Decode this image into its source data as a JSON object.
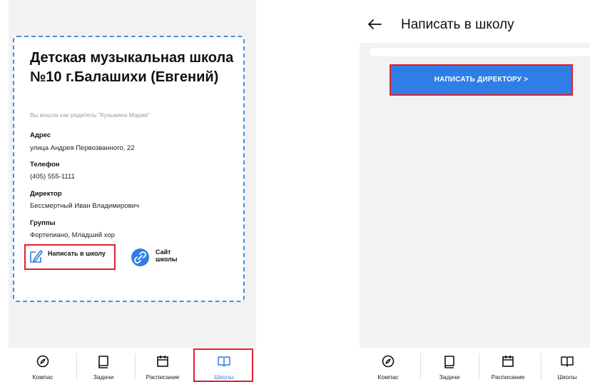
{
  "left_screen": {
    "school": {
      "title": "Детская музыкальная школа №10 г.Балашихи (Евгений)",
      "login_note": "Вы вошли как родитель \"Кузьмина Мария\"",
      "address_label": "Адрес",
      "address_value": "улица Андрея Первозванного, 22",
      "phone_label": "Телефон",
      "phone_value": "(405) 555-1111",
      "director_label": "Директор",
      "director_value": "Бессмертный Иван Владимирович",
      "groups_label": "Группы",
      "groups_value": "Фортепиано, Младший хор",
      "write_label": "Написать в школу",
      "site_label": "Сайт школы"
    },
    "tabs": [
      {
        "label": "Компас",
        "icon": "compass-icon"
      },
      {
        "label": "Задачи",
        "icon": "book-icon"
      },
      {
        "label": "Расписание",
        "icon": "calendar-icon"
      },
      {
        "label": "Школы",
        "icon": "open-book-icon",
        "active": true
      }
    ]
  },
  "right_screen": {
    "title": "Написать в школу",
    "button_label": "НАПИСАТЬ ДИРЕКТОРУ >",
    "tabs": [
      {
        "label": "Компас",
        "icon": "compass-icon"
      },
      {
        "label": "Задачи",
        "icon": "book-icon"
      },
      {
        "label": "Расписание",
        "icon": "calendar-icon"
      },
      {
        "label": "Школы",
        "icon": "open-book-icon"
      }
    ]
  },
  "colors": {
    "accent": "#2f7ee6",
    "highlight": "#e02030",
    "background": "#f2f2f2"
  }
}
